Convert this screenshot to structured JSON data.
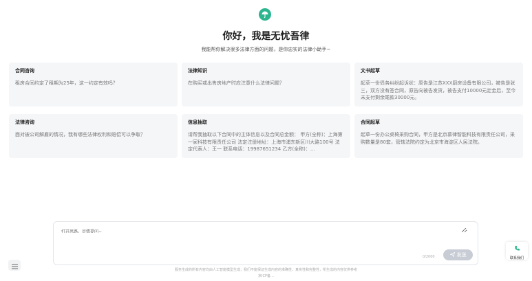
{
  "header": {
    "title": "你好，我是无忧吾律",
    "subtitle": "我能帮你解决很多法律方面的问题，是你忠实的法律小助手~"
  },
  "cards": [
    {
      "title": "合同咨询",
      "body": "租房合同约定了租期为25年，这一约定有效吗？"
    },
    {
      "title": "法律知识",
      "body": "在购买或出售房地产时应注意什么法律问题？"
    },
    {
      "title": "文书起草",
      "body": "起草一份债务纠纷起诉状：原告是江苏XXX厨房设备有限公司，被告是张三，双方没有签合同，原告向被告发货，被告支付10000元定金后，至今未支付剩余尾款30000元。"
    },
    {
      "title": "法律咨询",
      "body": "面对被公司解雇的情况，我有哪些法律权利和赔偿可以争取？"
    },
    {
      "title": "信息抽取",
      "body": "请帮我抽取以下合同中的主体信息以及合同总金额： 甲方(全称)：上海第一家科技有限责任公司 法定注册地址：上海市浦东新区川大路100号 法定代表人：王一 联系电话：19987651234 乙方(全称)：…"
    },
    {
      "title": "合同起草",
      "body": "起草一份办公桌椅采购合同，甲方是北京慕律智能科技有限责任公司，采购数量是80套，管辖法院约定为北京市海淀区人民法院。"
    }
  ],
  "input": {
    "placeholder": "打开思路，尽情提问~",
    "counter": "0/2000",
    "send_label": "发送"
  },
  "contact": {
    "label": "联系我们"
  },
  "footer": {
    "disclaimer": "服务生成的所有内容均由人工智能模型生成，我们不能保证生成内容的准确性、真实性和完整性，所生成的内容仅供参考",
    "icp": "京ICP备…"
  },
  "colors": {
    "brand": "#2bb68f",
    "send_bg": "#c8cdd5"
  }
}
